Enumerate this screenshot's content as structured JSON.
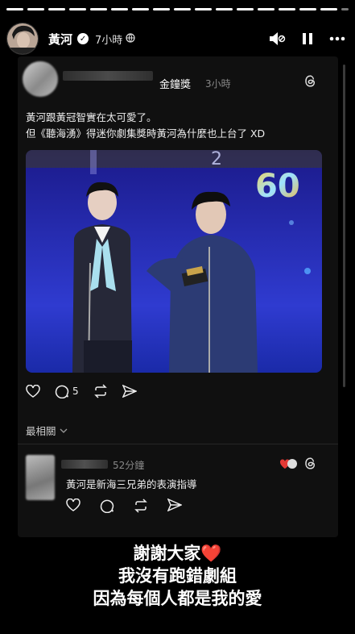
{
  "story": {
    "progress_segments": 17,
    "username": "黃河",
    "verified_icon": "verified-badge-icon",
    "time": "7小時",
    "privacy_icon": "globe-icon"
  },
  "post": {
    "author": "金鐘獎",
    "time": "3小時",
    "lines": [
      "黃河跟黃冠智實在太可愛了。",
      "但《聽海湧》得迷你劇集獎時黃河為什麼也上台了 XD"
    ],
    "photo_badge": "60",
    "replies_count": "5"
  },
  "sort": {
    "label": "最相關"
  },
  "comment": {
    "time": "52分鐘",
    "text": "黃河是新海三兄弟的表演指導"
  },
  "caption": {
    "line1": "謝謝大家",
    "line1_emoji": "❤️",
    "line2": "我沒有跑錯劇組",
    "line3": "因為每個人都是我的愛"
  },
  "colors": {
    "background": "#000000",
    "card": "#101010",
    "heart": "#e53935"
  }
}
